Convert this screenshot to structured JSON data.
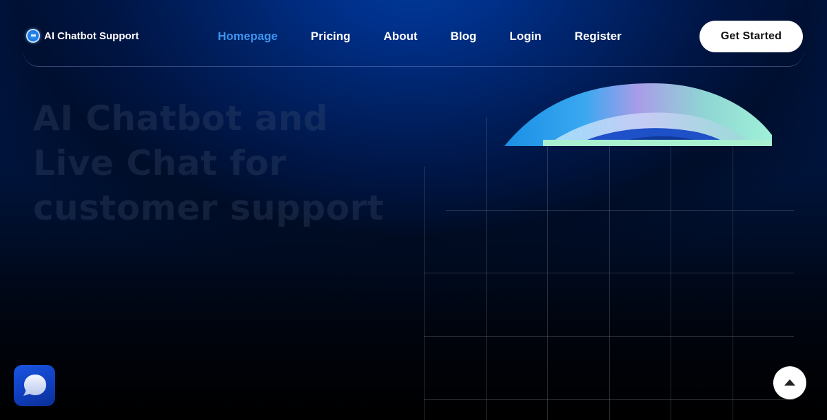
{
  "brand": {
    "name": "AI Chatbot Support",
    "icon": "chat-bubble-icon"
  },
  "nav": {
    "items": [
      {
        "label": "Homepage",
        "active": true
      },
      {
        "label": "Pricing",
        "active": false
      },
      {
        "label": "About",
        "active": false
      },
      {
        "label": "Blog",
        "active": false
      },
      {
        "label": "Login",
        "active": false
      },
      {
        "label": "Register",
        "active": false
      }
    ],
    "active_color": "#3d95f0"
  },
  "header": {
    "cta_label": "Get Started"
  },
  "hero": {
    "title_lines": [
      "AI Chatbot and",
      "Live Chat for",
      "customer support"
    ]
  },
  "widgets": {
    "chat_fab_icon": "chat-bubble-icon",
    "scroll_top_icon": "arrow-up-icon"
  },
  "colors": {
    "background_top": "#00308a",
    "background_bottom": "#000000",
    "cta_bg": "#ffffff",
    "chat_fab_bg": "#1a55e0"
  }
}
